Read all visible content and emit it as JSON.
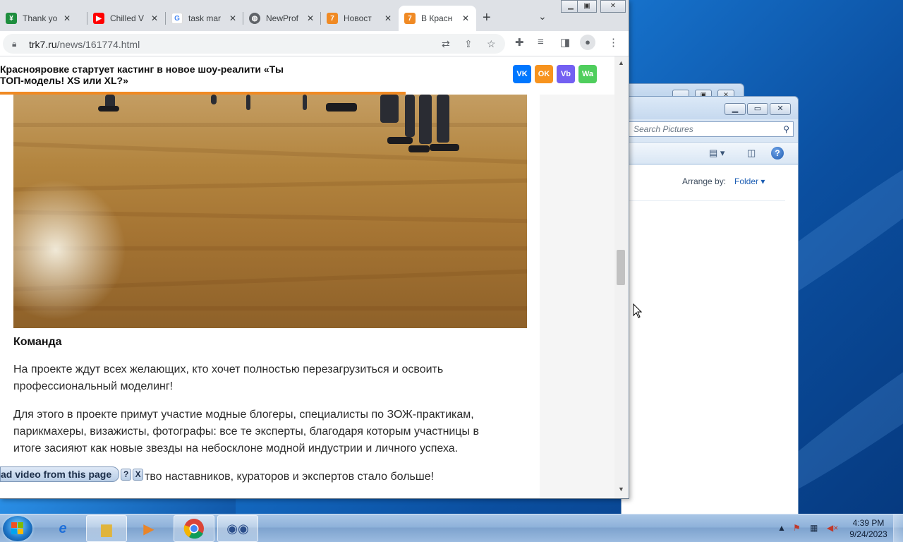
{
  "browser": {
    "tabs": [
      {
        "title": "Thank yo",
        "favicon": "green-square-icon",
        "color": "#1e8e3e"
      },
      {
        "title": "Chilled V",
        "favicon": "youtube-icon",
        "color": "#ff0000"
      },
      {
        "title": "task mar",
        "favicon": "google-icon",
        "color": "#4285f4"
      },
      {
        "title": "NewProf",
        "favicon": "globe-icon",
        "color": "#5f6368"
      },
      {
        "title": "Новост",
        "favicon": "trk7-icon",
        "color": "#f08a24"
      },
      {
        "title": "В Красн",
        "favicon": "trk7-icon",
        "color": "#f08a24"
      }
    ],
    "active_tab_index": 5,
    "url_domain": "trk7.ru",
    "url_path": "/news/161774.html"
  },
  "page": {
    "headline": "Красноярovке стартует кастинг в новое шоу-реалити «Ты ТОП-модель! XS или XL?»",
    "headline_line1": "Краснояровке стартует кастинг в новое шоу-реалити «Ты",
    "headline_line2": "ТОП-модель! XS или XL?»",
    "share": {
      "vk": "VK",
      "ok": "OK",
      "viber": "Vb",
      "whatsapp": "Wa"
    },
    "read_progress": 0.66,
    "section_title": "Команда",
    "paragraphs": [
      "На проекте ждут всех желающих, кто хочет полностью перезагрузиться и освоить профессиональный моделинг!",
      "Для этого в проекте примут участие модные блогеры, специалисты по ЗОЖ-практикам, парикмахеры, визажисты, фотографы: все те эксперты, благодаря которым участницы в итоге засияют как новые звезды на небосклоне модной индустрии и личного успеха.",
      "тво наставников, кураторов и экспертов стало больше!"
    ]
  },
  "download_bar": {
    "label": "ad video from this page",
    "help": "?",
    "close": "X"
  },
  "explorer": {
    "search_placeholder": "Search Pictures",
    "arrange_label": "Arrange by:",
    "arrange_value": "Folder"
  },
  "taskbar": {
    "clock_time": "4:39 PM",
    "clock_date": "9/24/2023"
  }
}
